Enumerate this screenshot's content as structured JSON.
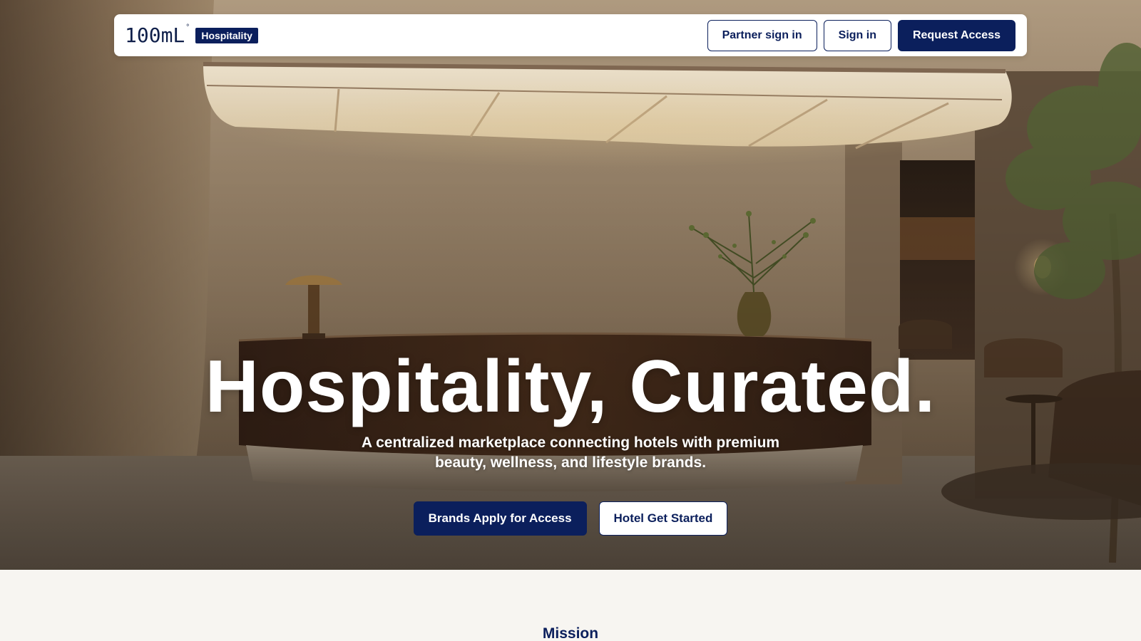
{
  "nav": {
    "logo_text": "100mL",
    "logo_mark": "°",
    "badge": "Hospitality",
    "partner_sign_in": "Partner sign in",
    "sign_in": "Sign in",
    "request_access": "Request Access"
  },
  "hero": {
    "title": "Hospitality, Curated.",
    "subtitle": "A centralized marketplace connecting hotels with premium beauty, wellness, and lifestyle brands.",
    "cta_brands": "Brands Apply for Access",
    "cta_hotel": "Hotel Get Started",
    "background_image": "hotel-lobby-reception-desk"
  },
  "mission": {
    "heading": "Mission"
  },
  "colors": {
    "brand_navy": "#0b1f5c",
    "page_bg": "#f7f5f1",
    "white": "#ffffff"
  }
}
